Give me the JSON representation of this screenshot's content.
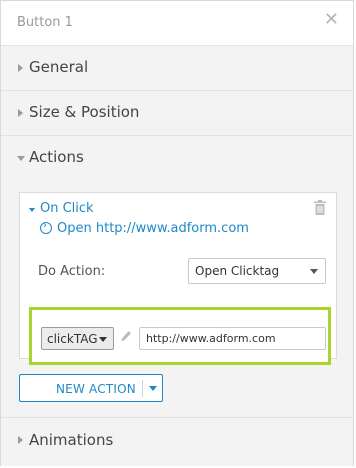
{
  "panel": {
    "title": "Button 1"
  },
  "sections": {
    "general": "General",
    "size_position": "Size & Position",
    "actions": "Actions",
    "animations": "Animations"
  },
  "action": {
    "trigger_label": "On Click",
    "summary": "Open http://www.adform.com",
    "do_action_label": "Do Action:",
    "do_action_value": "Open Clicktag",
    "clicktag_value": "clickTAG",
    "url_value": "http://www.adform.com"
  },
  "new_action_label": "NEW ACTION",
  "colors": {
    "accent": "#1e88c8",
    "highlight": "#a6d530",
    "panel_bg": "#f3f3f3"
  },
  "icons": [
    "close-icon",
    "trash-icon",
    "arrow-circle-icon",
    "pencil-icon",
    "chevron-down-icon",
    "chevron-right-icon"
  ]
}
